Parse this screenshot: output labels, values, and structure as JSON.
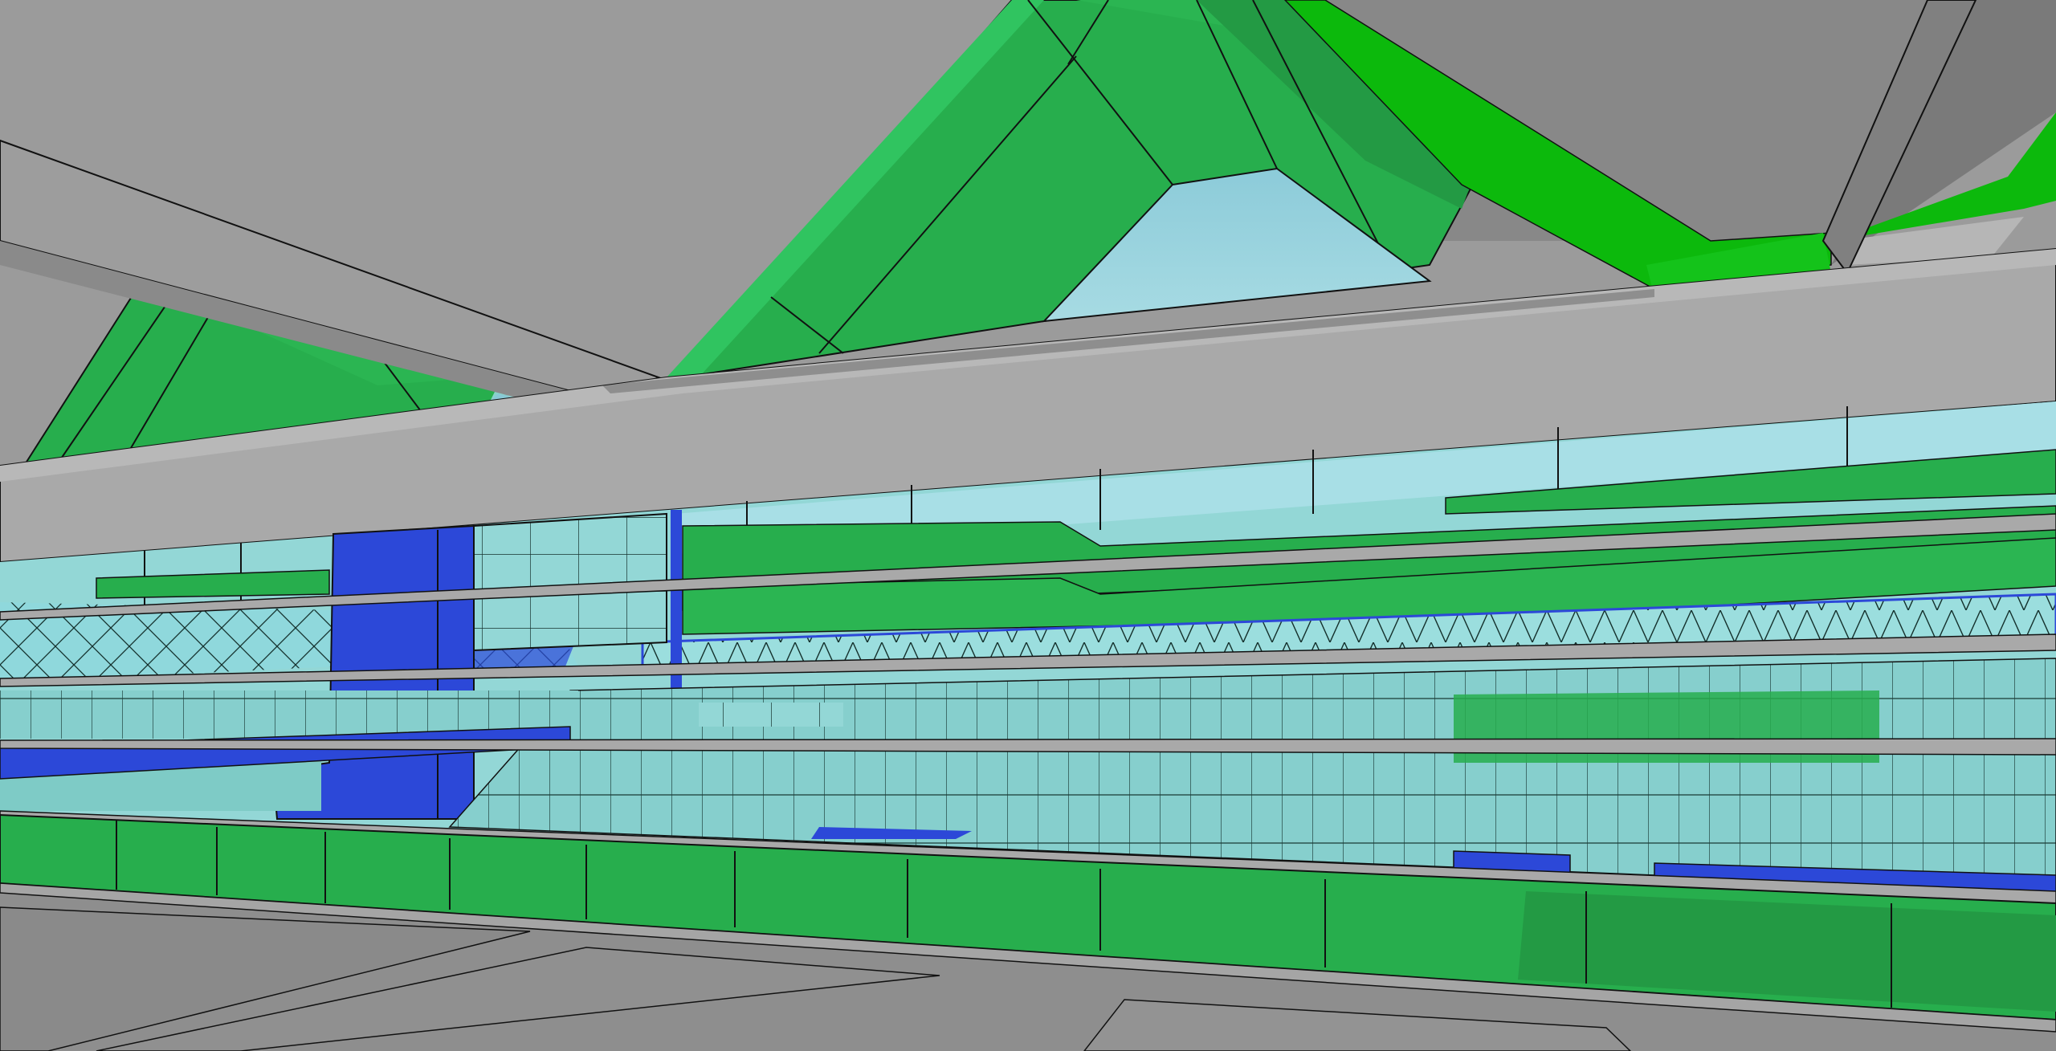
{
  "scene": {
    "description_visible_text": "",
    "palette": {
      "concrete_light": "#a9a9a9",
      "concrete_mid": "#969696",
      "concrete_dark": "#7c7c7c",
      "roof_green": "#27ae4d",
      "roof_green_dark": "#239a44",
      "roof_green_bright": "#0cb90c",
      "glass_cyan": "#93d7d6",
      "glass_cyan_dark": "#74bcbc",
      "sky_blue": "#8ac8d8",
      "accent_blue": "#2c48d8",
      "edge_black": "#111111"
    }
  }
}
